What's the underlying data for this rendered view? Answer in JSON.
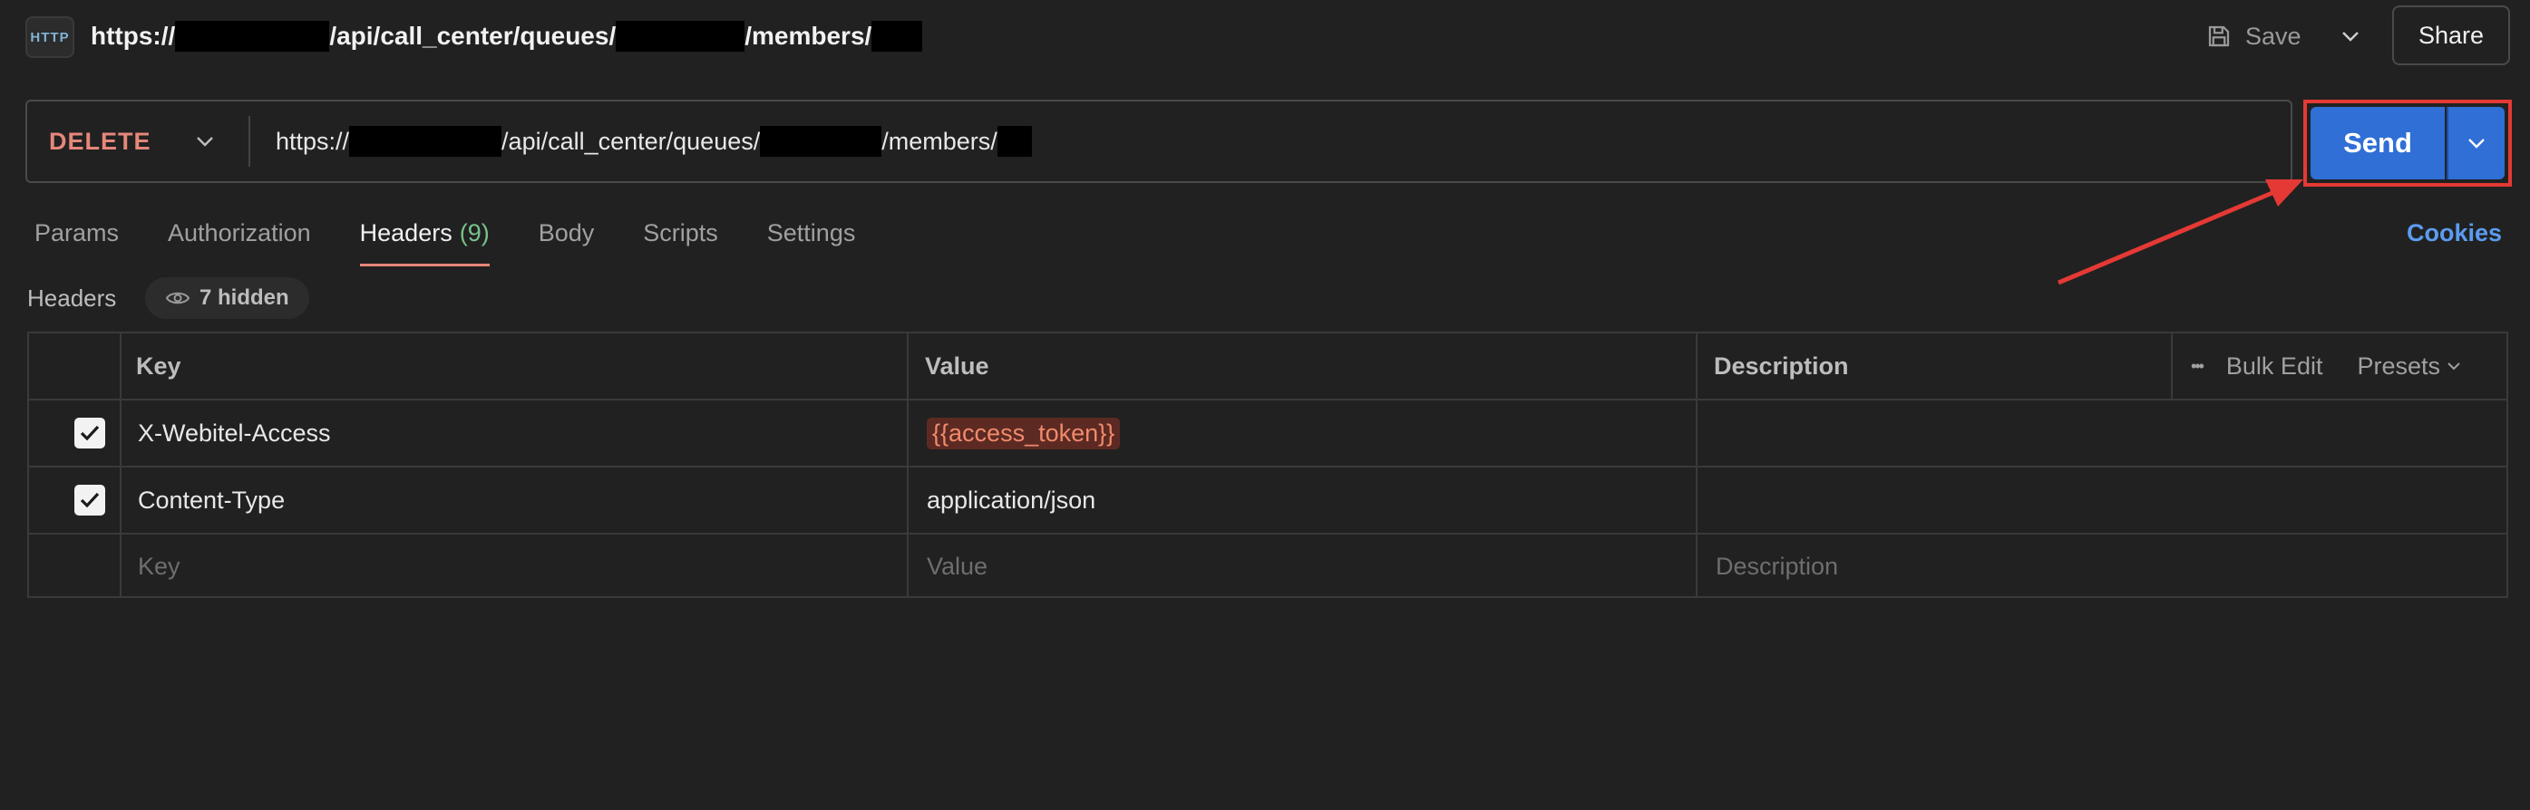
{
  "top_bar": {
    "http_icon_text": "HTTP",
    "url_parts": [
      "https://",
      "/api/call_center/queues/",
      "/members/"
    ],
    "save_label": "Save",
    "share_label": "Share"
  },
  "request": {
    "method": "DELETE",
    "url_parts": [
      "https://",
      "/api/call_center/queues/",
      "/members/"
    ],
    "send_label": "Send"
  },
  "tabs": [
    {
      "label": "Params"
    },
    {
      "label": "Authorization"
    },
    {
      "label": "Headers",
      "count": "(9)"
    },
    {
      "label": "Body"
    },
    {
      "label": "Scripts"
    },
    {
      "label": "Settings"
    }
  ],
  "cookies_label": "Cookies",
  "headers_section": {
    "title": "Headers",
    "hidden_label": "7 hidden"
  },
  "table": {
    "columns": [
      "Key",
      "Value",
      "Description"
    ],
    "actions": {
      "more": "•••",
      "bulk_edit": "Bulk Edit",
      "presets": "Presets"
    },
    "rows": [
      {
        "checked": true,
        "key": "X-Webitel-Access",
        "value": "{{access_token}}",
        "description": ""
      },
      {
        "checked": true,
        "key": "Content-Type",
        "value": "application/json",
        "description": ""
      }
    ],
    "placeholders": {
      "key": "Key",
      "value": "Value",
      "description": "Description"
    }
  },
  "colors": {
    "background": "#212121",
    "method": "#e5877a",
    "send": "#2f6fd6",
    "highlight_outline": "#e53935",
    "cookies": "#5b9cf0",
    "tab_count": "#78c28a"
  },
  "icons": [
    "http-icon",
    "save-icon",
    "chevron-down-icon",
    "eye-icon",
    "checkbox-checked-icon",
    "annotation-arrow"
  ]
}
